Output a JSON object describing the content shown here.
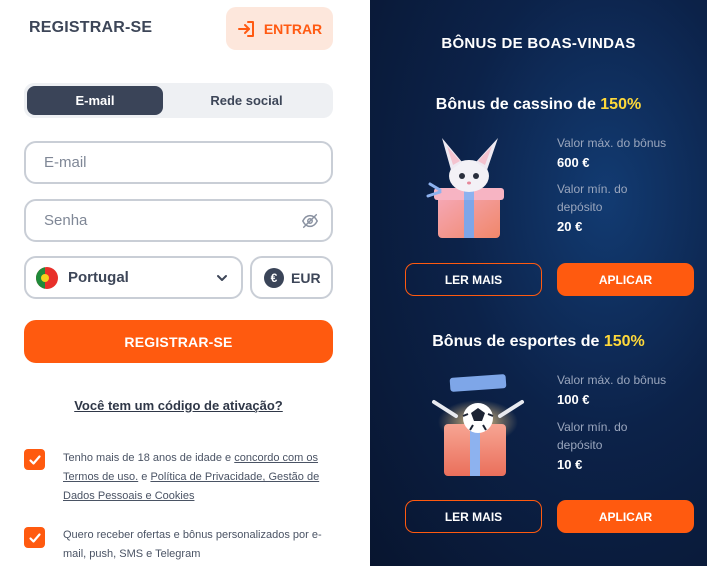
{
  "header": {
    "title": "REGISTRAR-SE",
    "login_label": "ENTRAR"
  },
  "tabs": [
    {
      "label": "E-mail",
      "active": true
    },
    {
      "label": "Rede social",
      "active": false
    }
  ],
  "form": {
    "email_placeholder": "E-mail",
    "password_placeholder": "Senha",
    "country": "Portugal",
    "currency": "EUR",
    "currency_symbol": "€",
    "submit_label": "REGISTRAR-SE",
    "promo_link": "Você tem um código de ativação?"
  },
  "consents": [
    {
      "checked": true,
      "text_before": "Tenho mais de 18 anos de idade e ",
      "link1": "concordo com os Termos de uso.",
      "text_mid": " e ",
      "link2": "Política de Privacidade, Gestão de Dados Pessoais e Cookies"
    },
    {
      "checked": true,
      "text": "Quero receber ofertas e bônus personalizados por e-mail, push, SMS e Telegram"
    }
  ],
  "bonus_panel": {
    "title": "BÔNUS DE BOAS-VINDAS",
    "bonuses": [
      {
        "title": "Bônus de cassino de ",
        "percent": "150%",
        "max_label": "Valor máx. do bônus",
        "max_value": "600 €",
        "min_label": "Valor mín. do depósito",
        "min_value": "20 €",
        "more_label": "LER MAIS",
        "apply_label": "APLICAR",
        "image_icon": "fox-gift-box-icon"
      },
      {
        "title": "Bônus de esportes de ",
        "percent": "150%",
        "max_label": "Valor máx. do bônus",
        "max_value": "100 €",
        "min_label": "Valor mín. do depósito",
        "min_value": "10 €",
        "more_label": "LER MAIS",
        "apply_label": "APLICAR",
        "image_icon": "soccer-gift-box-icon"
      }
    ]
  },
  "colors": {
    "accent": "#ff5a0f",
    "highlight": "#ffd93a",
    "panel_bg": "#0c2249",
    "dark_text": "#3d4658"
  }
}
